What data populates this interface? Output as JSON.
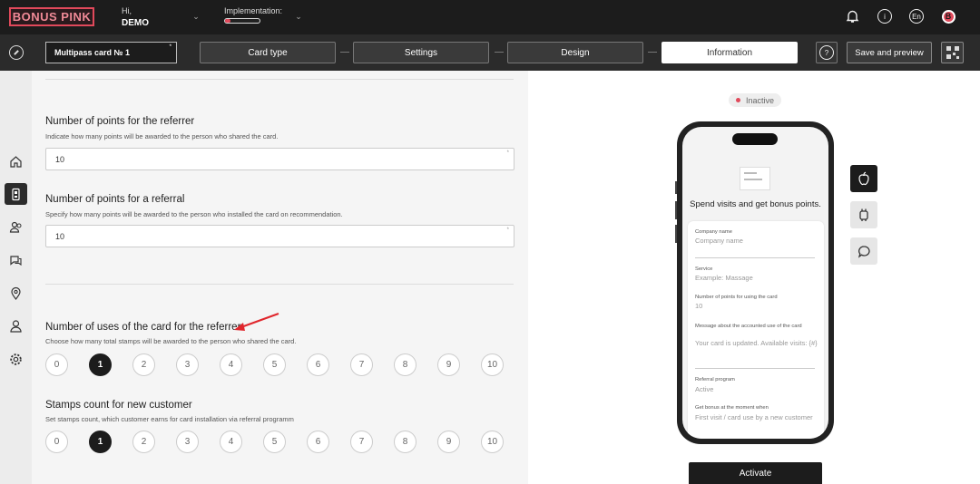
{
  "brand": {
    "logo": "BONUS PINK",
    "accent": "#e1495b"
  },
  "header": {
    "greeting": "Hi,",
    "user": "DEMO",
    "implementation_label": "Implementation:",
    "implementation_progress": 0.15,
    "language": "En",
    "avatar_letter": "B"
  },
  "toolbar": {
    "card_name": "Multipass card № 1",
    "required_mark": "*",
    "steps": [
      "Card type",
      "Settings",
      "Design",
      "Information"
    ],
    "active_step": "Information",
    "save_label": "Save and preview"
  },
  "nav": {
    "items": [
      "home",
      "cards",
      "clients",
      "messages",
      "locations",
      "profile",
      "settings"
    ],
    "active": "cards"
  },
  "form": {
    "referrer_points": {
      "title": "Number of points for the referrer",
      "desc": "Indicate how many points will be awarded to the person who shared the card.",
      "value": "10"
    },
    "referral_points": {
      "title": "Number of points for a referral",
      "desc": "Specify how many points will be awarded to the person who installed the card on recommendation.",
      "value": "10"
    },
    "referrer_uses": {
      "title": "Number of uses of the card for the referrer",
      "desc": "Choose how many total stamps will be awarded to the person who shared the card.",
      "options": [
        "0",
        "1",
        "2",
        "3",
        "4",
        "5",
        "6",
        "7",
        "8",
        "9",
        "10"
      ],
      "selected": "1"
    },
    "new_customer_stamps": {
      "title": "Stamps count for new customer",
      "desc": "Set stamps count, which customer earns for card installation via referral programm",
      "options": [
        "0",
        "1",
        "2",
        "3",
        "4",
        "5",
        "6",
        "7",
        "8",
        "9",
        "10"
      ],
      "selected": "1"
    }
  },
  "preview": {
    "status": "Inactive",
    "slogan": "Spend visits and get bonus points.",
    "fields": [
      {
        "label": "Company name",
        "value": "Company name"
      },
      {
        "label": "Service",
        "value": "Example: Massage"
      },
      {
        "label": "Number of points for using the card",
        "value": "10"
      },
      {
        "label": "Message about the accounted use of the card",
        "value": "Your card is updated. Available visits: {#}"
      },
      {
        "label": "Referral program",
        "value": "Active"
      },
      {
        "label": "Get bonus at the moment when",
        "value": "First visit / card use by a new customer"
      }
    ],
    "platforms": [
      "apple-icon",
      "android-icon",
      "chat-icon"
    ],
    "activate_label": "Activate"
  }
}
